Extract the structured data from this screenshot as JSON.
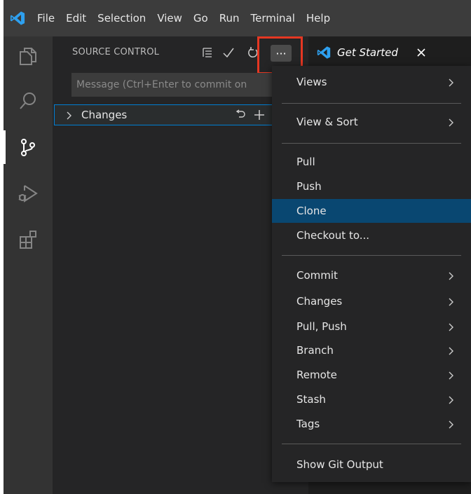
{
  "menubar": {
    "items": [
      "File",
      "Edit",
      "Selection",
      "View",
      "Go",
      "Run",
      "Terminal",
      "Help"
    ]
  },
  "activitybar": {
    "items": [
      "explorer-icon",
      "search-icon",
      "source-control-icon",
      "run-debug-icon",
      "extensions-icon"
    ],
    "active": "source-control-icon"
  },
  "sidebar": {
    "title": "SOURCE CONTROL",
    "toolbar_icons": [
      "view-as-tree-icon",
      "commit-check-icon",
      "refresh-icon",
      "more-actions-icon"
    ],
    "more_label": "···",
    "message_placeholder": "Message (Ctrl+Enter to commit on",
    "changes_label": "Changes"
  },
  "tab": {
    "label": "Get Started",
    "close": "×"
  },
  "context_menu": {
    "items": [
      {
        "label": "Views",
        "submenu": true
      },
      {
        "label": "View & Sort",
        "submenu": true
      },
      {
        "label": "Pull",
        "submenu": false
      },
      {
        "label": "Push",
        "submenu": false
      },
      {
        "label": "Clone",
        "submenu": false,
        "selected": true
      },
      {
        "label": "Checkout to...",
        "submenu": false
      },
      {
        "label": "Commit",
        "submenu": true
      },
      {
        "label": "Changes",
        "submenu": true
      },
      {
        "label": "Pull, Push",
        "submenu": true
      },
      {
        "label": "Branch",
        "submenu": true
      },
      {
        "label": "Remote",
        "submenu": true
      },
      {
        "label": "Stash",
        "submenu": true
      },
      {
        "label": "Tags",
        "submenu": true
      },
      {
        "label": "Show Git Output",
        "submenu": false
      }
    ]
  },
  "colors": {
    "accent": "#007fd4",
    "vscode_blue": "#2ea0ef",
    "highlight": "#e53722",
    "menu_selected": "#094771"
  }
}
